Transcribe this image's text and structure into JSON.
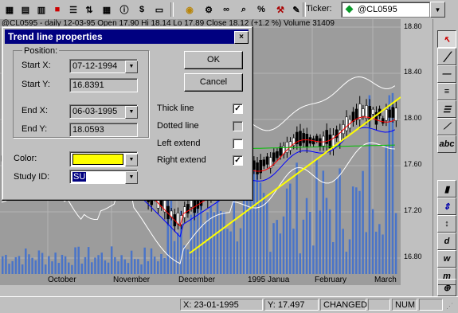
{
  "toolbar": {
    "ticker_label": "Ticker:",
    "ticker_value": "@CL0595"
  },
  "chart": {
    "info_line": "@CL0595 - daily  12-03-95  Open 17.90  Hi 18.14  Lo 17.89  Close 18.12  (+1.2 %)  Volume 31409",
    "price_ticks": [
      "18.80",
      "18.40",
      "18.00",
      "17.60",
      "17.20",
      "16.80"
    ],
    "month_labels": [
      "October",
      "November",
      "December",
      "1995 Janua",
      "February",
      "March"
    ]
  },
  "dialog": {
    "title": "Trend line properties",
    "position_group_label": "Position:",
    "start_x_label": "Start X:",
    "start_x_value": "07-12-1994",
    "start_y_label": "Start Y:",
    "start_y_value": "16.8391",
    "end_x_label": "End X:",
    "end_x_value": "06-03-1995",
    "end_y_label": "End Y:",
    "end_y_value": "18.0593",
    "color_label": "Color:",
    "color_value": "#ffff00",
    "study_id_label": "Study ID:",
    "study_id_value": "SU",
    "ok_label": "OK",
    "cancel_label": "Cancel",
    "thick_line_label": "Thick line",
    "thick_line_checked": true,
    "dotted_line_label": "Dotted line",
    "dotted_line_checked": false,
    "left_extend_label": "Left extend",
    "left_extend_checked": false,
    "right_extend_label": "Right extend",
    "right_extend_checked": true
  },
  "statusbar": {
    "x_readout": "X: 23-01-1995",
    "y_readout": "Y: 17.497",
    "mode": "CHANGED",
    "num": "NUM"
  },
  "colors": {
    "trendline": "#ffff00",
    "bands": "#ffffff",
    "ma_short": "#ff0000",
    "ma_mid": "#0000ff",
    "ma_long": "#00c000",
    "volume": "#4a74c8",
    "title_bar": "#000080"
  }
}
